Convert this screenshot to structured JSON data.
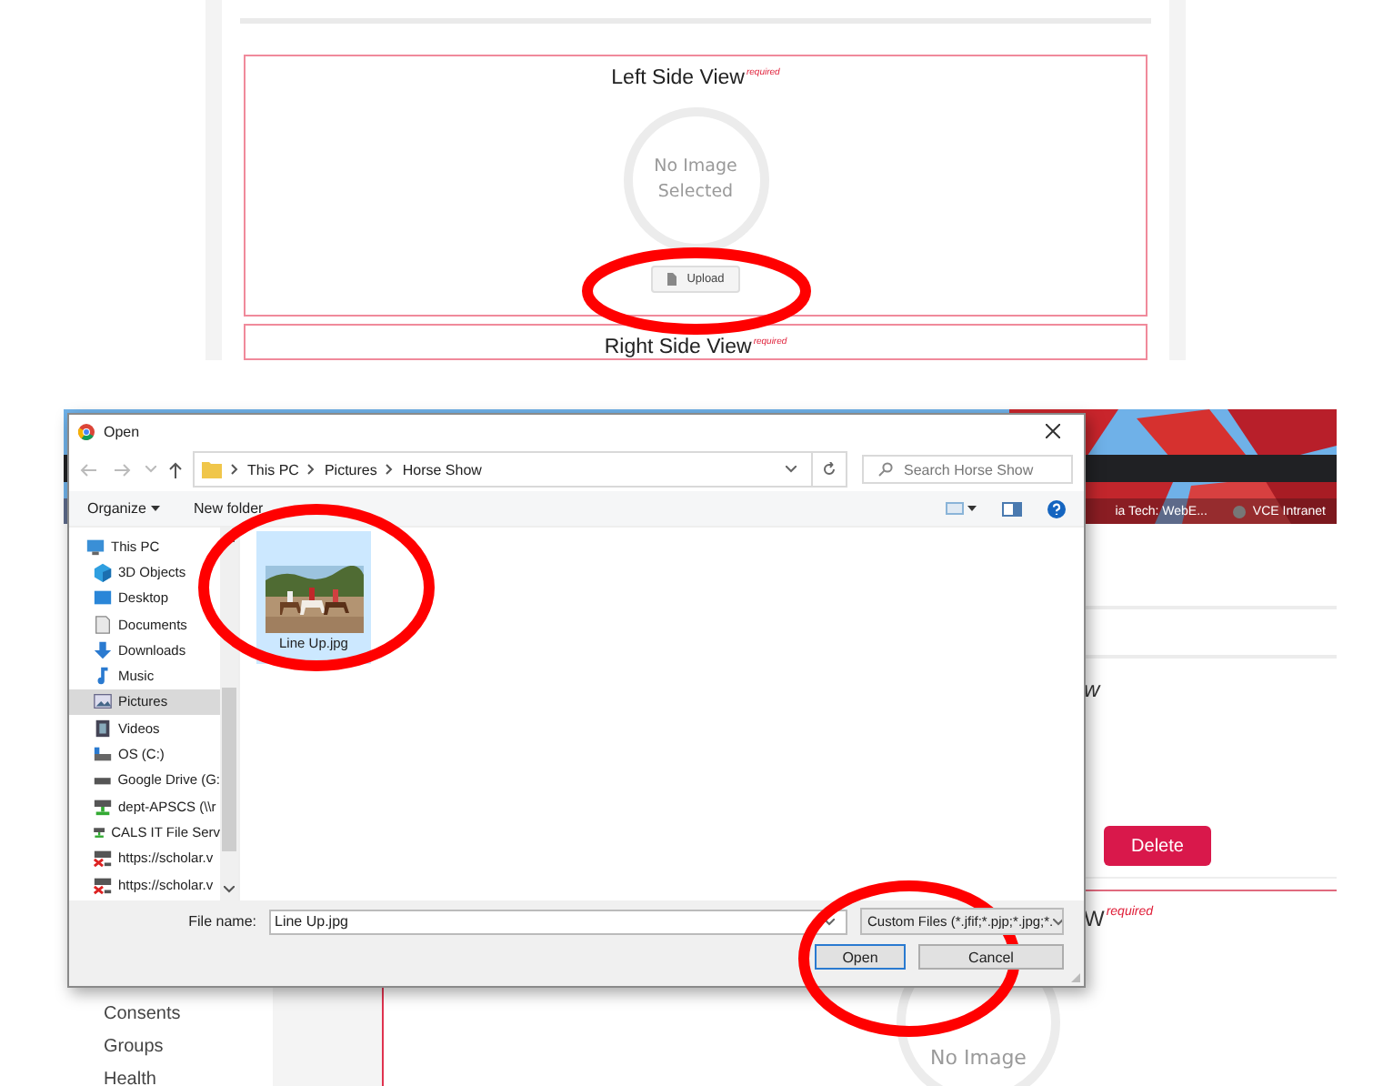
{
  "upload_form": {
    "sections": [
      {
        "title": "Left Side View",
        "required": "required",
        "empty_text": "No Image Selected",
        "upload_button": "Upload"
      },
      {
        "title": "Right Side View",
        "required": "required"
      }
    ]
  },
  "browser": {
    "bookmarks": [
      "ia Tech: WebE...",
      "VCE Intranet"
    ]
  },
  "page": {
    "sidebar_items": [
      "Consents",
      "Groups",
      "Health"
    ],
    "title_fragment": "w",
    "delete_button": "Delete",
    "next_title_fragment": "W",
    "required": "required",
    "empty_text": "No Image"
  },
  "dialog": {
    "title": "Open",
    "breadcrumb": [
      "This PC",
      "Pictures",
      "Horse Show"
    ],
    "search": {
      "placeholder": "Search Horse Show"
    },
    "toolbar": [
      "Organize",
      "New folder"
    ],
    "nav_items": [
      {
        "label": "This PC",
        "selected": false,
        "children": [
          {
            "label": "3D Objects",
            "selected": false
          },
          {
            "label": "Desktop",
            "selected": false
          },
          {
            "label": "Documents",
            "selected": false
          },
          {
            "label": "Downloads",
            "selected": false
          },
          {
            "label": "Music",
            "selected": false
          },
          {
            "label": "Pictures",
            "selected": true
          },
          {
            "label": "Videos",
            "selected": false
          },
          {
            "label": "OS (C:)",
            "selected": false
          },
          {
            "label": "Google Drive (G:",
            "selected": false
          },
          {
            "label": "dept-APSCS (\\\\r",
            "selected": false
          },
          {
            "label": "CALS IT File Serv",
            "selected": false
          },
          {
            "label": "https://scholar.v",
            "selected": false
          },
          {
            "label": "https://scholar.v",
            "selected": false
          }
        ]
      }
    ],
    "files": [
      {
        "name": "Line Up.jpg",
        "selected": true,
        "kind": "picture"
      }
    ],
    "file_name_label": "File name:",
    "file_name": "Line Up.jpg",
    "file_type": "Custom Files (*.jfif;*.pjp;*.jpg;*.",
    "buttons": [
      {
        "label": "Open",
        "default": true
      },
      {
        "label": "Cancel",
        "default": false
      }
    ]
  }
}
